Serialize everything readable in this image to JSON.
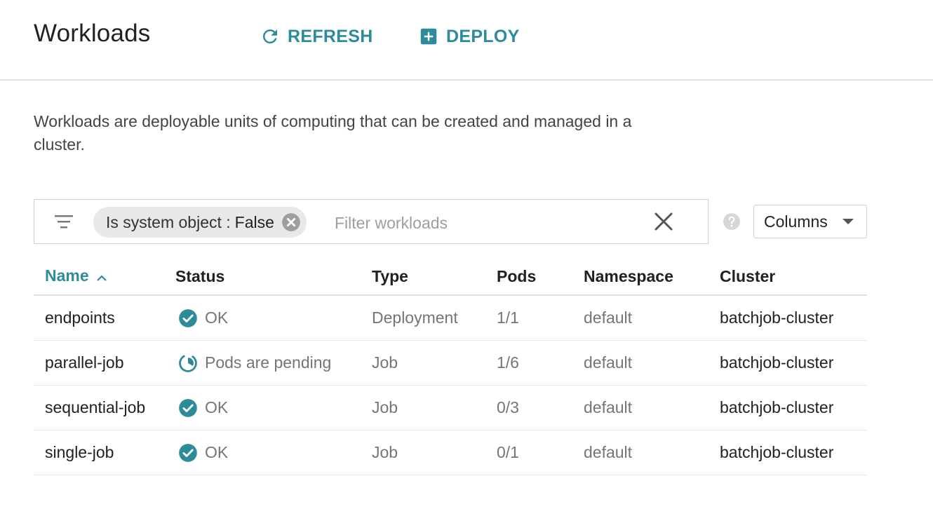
{
  "header": {
    "title": "Workloads",
    "refresh_label": "REFRESH",
    "deploy_label": "DEPLOY"
  },
  "description": "Workloads are deployable units of computing that can be created and managed in a cluster.",
  "filter": {
    "chip_label": "Is system object :",
    "chip_value": "False",
    "placeholder": "Filter workloads",
    "value": ""
  },
  "columns_button": "Columns",
  "table": {
    "headers": {
      "name": "Name",
      "status": "Status",
      "type": "Type",
      "pods": "Pods",
      "namespace": "Namespace",
      "cluster": "Cluster"
    },
    "rows": [
      {
        "name": "endpoints",
        "status": "OK",
        "status_icon": "check-circle-icon",
        "type": "Deployment",
        "pods": "1/1",
        "namespace": "default",
        "cluster": "batchjob-cluster"
      },
      {
        "name": "parallel-job",
        "status": "Pods are pending",
        "status_icon": "pending-icon",
        "type": "Job",
        "pods": "1/6",
        "namespace": "default",
        "cluster": "batchjob-cluster"
      },
      {
        "name": "sequential-job",
        "status": "OK",
        "status_icon": "check-circle-icon",
        "type": "Job",
        "pods": "0/3",
        "namespace": "default",
        "cluster": "batchjob-cluster"
      },
      {
        "name": "single-job",
        "status": "OK",
        "status_icon": "check-circle-icon",
        "type": "Job",
        "pods": "0/1",
        "namespace": "default",
        "cluster": "batchjob-cluster"
      }
    ]
  },
  "colors": {
    "accent": "#2e8b9a",
    "status_ok": "#2e8b9a"
  }
}
